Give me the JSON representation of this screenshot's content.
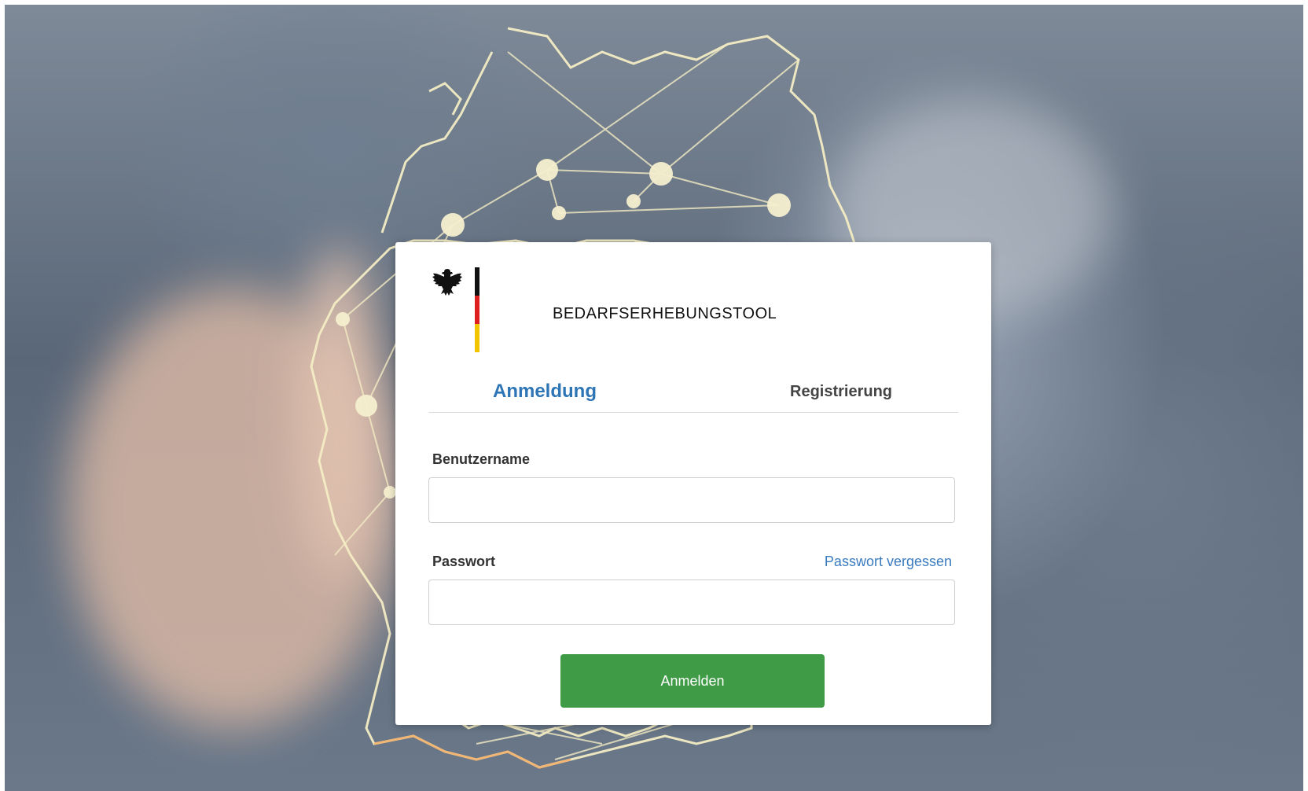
{
  "header": {
    "app_title": "Bedarfserhebungstool"
  },
  "tabs": [
    {
      "label": "Anmeldung",
      "active": true
    },
    {
      "label": "Registrierung",
      "active": false
    }
  ],
  "form": {
    "username_label": "Benutzername",
    "username_value": "",
    "password_label": "Passwort",
    "password_value": "",
    "forgot_link": "Passwort vergessen",
    "submit_label": "Anmelden"
  },
  "colors": {
    "accent": "#2e75b6",
    "button": "#3f9b45",
    "flag_black": "#111111",
    "flag_red": "#dd1f1f",
    "flag_gold": "#f2c500"
  },
  "icons": {
    "logo": "federal-eagle-icon"
  }
}
